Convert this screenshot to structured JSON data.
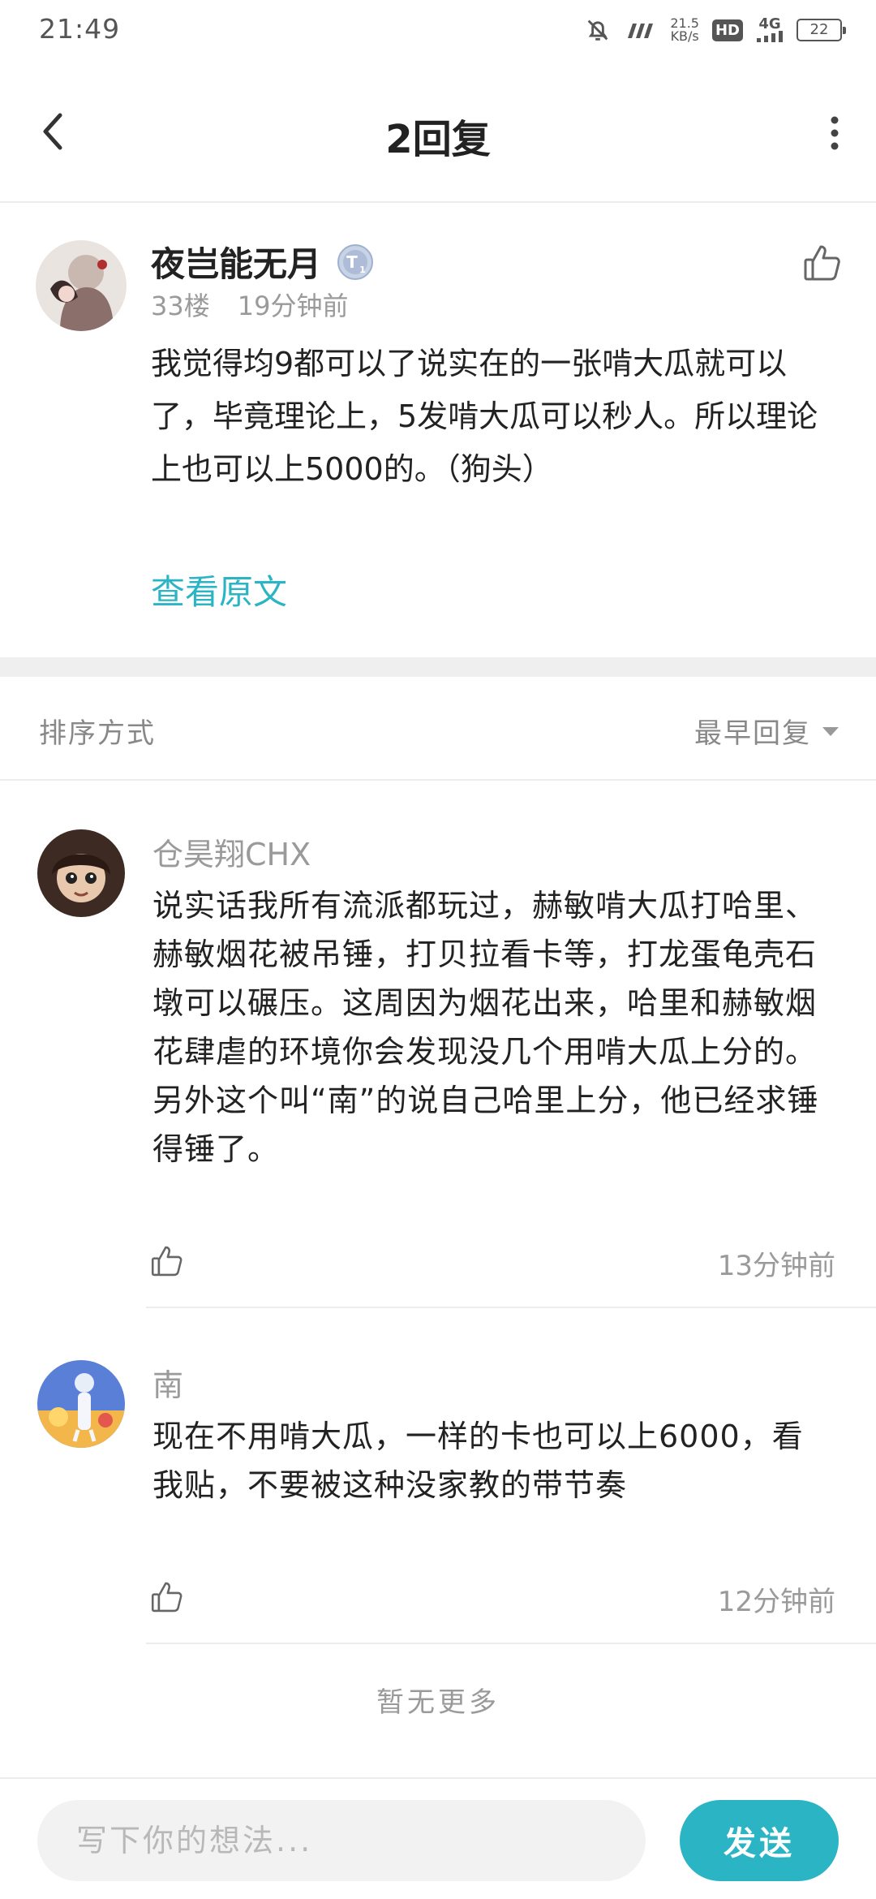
{
  "status_bar": {
    "time": "21:49",
    "net_speed_value": "21.5",
    "net_speed_unit": "KB/s",
    "hd_label": "HD",
    "network_label": "4G",
    "battery": "22",
    "icons": [
      "bell-off-icon",
      "signal-icon",
      "hd-icon",
      "4g-icon",
      "battery-icon"
    ]
  },
  "header": {
    "title": "2回复",
    "back_icon": "chevron-left-icon",
    "more_icon": "more-vertical-icon"
  },
  "post": {
    "author": "夜岂能无月",
    "badge_letter": "T",
    "badge_level": "1",
    "floor": "33楼",
    "time": "19分钟前",
    "body": "我觉得均9都可以了说实在的一张啃大瓜就可以了，毕竟理论上，5发啃大瓜可以秒人。所以理论上也可以上5000的。（狗头）",
    "view_original": "查看原文"
  },
  "sort": {
    "label": "排序方式",
    "selected": "最早回复"
  },
  "replies": [
    {
      "author": "仓昊翔CHX",
      "body": "说实话我所有流派都玩过，赫敏啃大瓜打哈里、赫敏烟花被吊锤，打贝拉看卡等，打龙蛋龟壳石墩可以碾压。这周因为烟花出来，哈里和赫敏烟花肆虐的环境你会发现没几个用啃大瓜上分的。另外这个叫“南”的说自己哈里上分，他已经求锤得锤了。",
      "time": "13分钟前"
    },
    {
      "author": "南",
      "body": "现在不用啃大瓜，一样的卡也可以上6000，看我贴，不要被这种没家教的带节奏",
      "time": "12分钟前"
    }
  ],
  "no_more": "暂无更多",
  "composer": {
    "placeholder": "写下你的想法...",
    "send_label": "发送"
  },
  "colors": {
    "accent": "#2bb5c4",
    "muted_text": "#9a9a9a",
    "divider": "#ececec"
  }
}
